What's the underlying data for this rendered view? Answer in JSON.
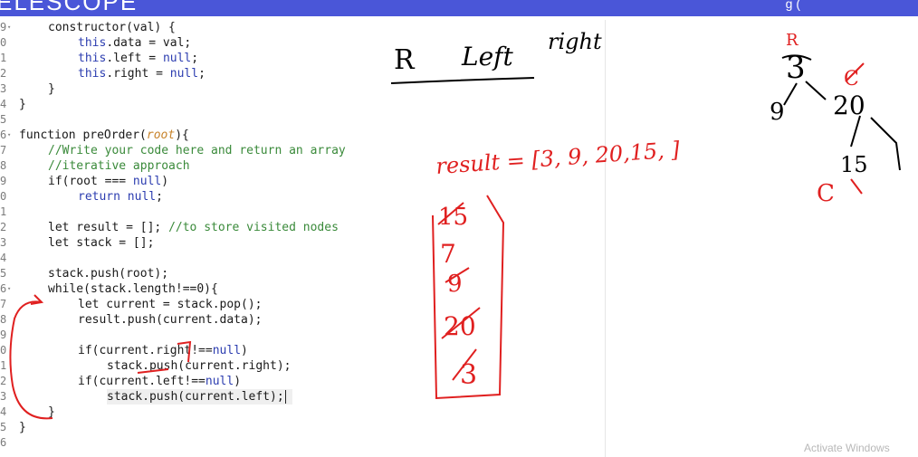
{
  "app": {
    "brand": "ELESCOPE",
    "top_right_glyph": "g  ("
  },
  "editor": {
    "line_numbers": [
      "9",
      "0",
      "1",
      "2",
      "3",
      "4",
      "5",
      "6",
      "7",
      "8",
      "9",
      "0",
      "1",
      "2",
      "3",
      "4",
      "5",
      "6",
      "7",
      "8",
      "9",
      "0",
      "1",
      "2",
      "3",
      "4",
      "5",
      "6"
    ],
    "folded_lines": [
      0,
      7,
      17
    ],
    "cursor_line": 24
  },
  "code": {
    "l0": [
      "constructor(val) {"
    ],
    "l1": [
      "this",
      ".data = val;"
    ],
    "l2": [
      "this",
      ".left = ",
      "null",
      ";"
    ],
    "l3": [
      "this",
      ".right = ",
      "null",
      ";"
    ],
    "l4": [
      "}"
    ],
    "l5": [
      "}"
    ],
    "l7": [
      "function preOrder(",
      "root",
      "){"
    ],
    "l8": [
      "//Write your code here and return an array"
    ],
    "l9": [
      "//iterative approach"
    ],
    "l10": [
      "if(root === ",
      "null",
      ")"
    ],
    "l11": [
      "return ",
      "null",
      ";"
    ],
    "l13": [
      "let result = []; ",
      "//to store visited nodes"
    ],
    "l14": [
      "let stack = [];"
    ],
    "l16": [
      "stack.push(root);"
    ],
    "l17": [
      "while(stack.length!==0){"
    ],
    "l18": [
      "let current = stack.pop();"
    ],
    "l19": [
      "result.push(current.data);"
    ],
    "l21": [
      "if(current.right!==",
      "null",
      ")"
    ],
    "l22": [
      "stack.push(current.right);"
    ],
    "l23": [
      "if(current.left!==",
      "null",
      ")"
    ],
    "l24": [
      "stack.push(current.left);"
    ],
    "l25": [
      "}"
    ],
    "l26": [
      "}"
    ]
  },
  "annotations": {
    "traversal_order": [
      "R",
      "Left",
      "right"
    ],
    "result_label": "result = [3, 9, 20,15, ]",
    "stack_items": [
      "15",
      "7",
      "9",
      "20",
      "3"
    ],
    "tree": {
      "root_marker": "R",
      "root": "3",
      "left": "9",
      "right": "20",
      "right_left": "15",
      "current_marker": "C",
      "struck_marker": "C"
    },
    "ink_color_black": "#000000",
    "ink_color_red": "#e02020"
  },
  "os": {
    "watermark": "Activate Windows"
  }
}
